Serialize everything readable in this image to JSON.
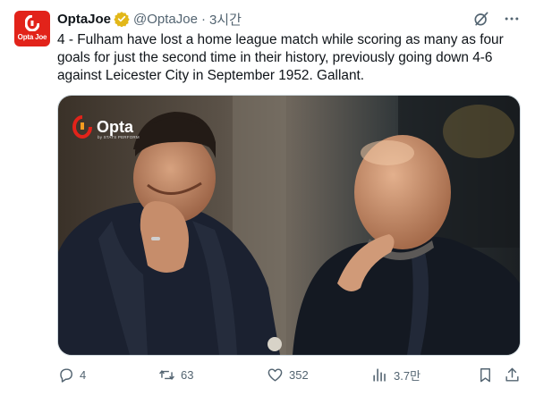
{
  "tweet": {
    "avatar_text": "Opta Joe",
    "display_name": "OptaJoe",
    "handle": "@OptaJoe",
    "separator": "·",
    "time": "3시간",
    "text": "4 - Fulham have lost a home league match while scoring as many as four goals for just the second time in their history, previously going down 4-6 against Leicester City in September 1952. Gallant.",
    "media": {
      "watermark_title": "Opta",
      "watermark_subtitle": "by STATS PERFORM"
    },
    "actions": {
      "replies": "4",
      "reposts": "63",
      "likes": "352",
      "views": "3.7만"
    }
  },
  "colors": {
    "opta_red": "#e2231a",
    "verified_gold": "#e2b719",
    "muted_text": "#536471",
    "jacket_navy": "#1b2130"
  },
  "icons": [
    "verified-badge-icon",
    "grok-icon",
    "more-icon",
    "reply-icon",
    "repost-icon",
    "like-icon",
    "views-icon",
    "bookmark-icon",
    "share-icon"
  ]
}
